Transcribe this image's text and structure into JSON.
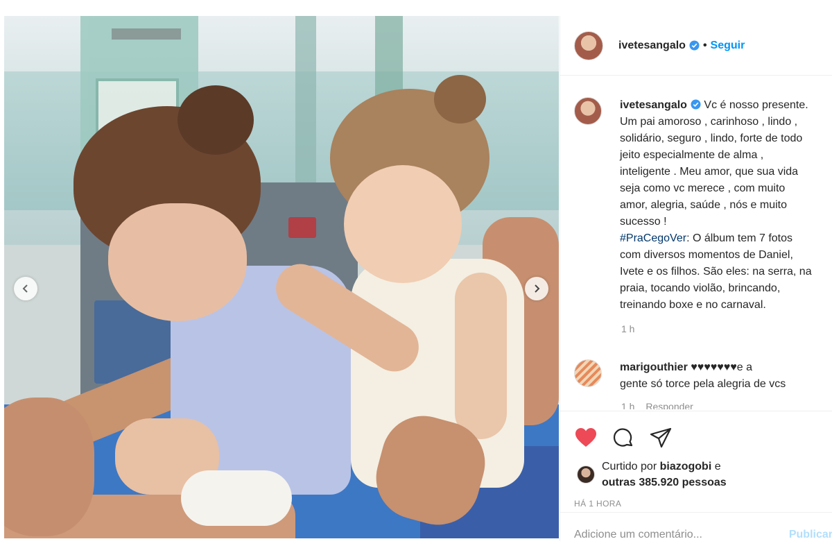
{
  "post": {
    "username": "ivetesangalo",
    "follow_label": "Seguir",
    "separator": "•",
    "caption_lines": [
      "Vc é nosso presente.",
      "Um pai amoroso , carinhoso , lindo ,",
      "solidário, seguro , lindo, forte de todo",
      "jeito especialmente de alma ,",
      "inteligente . Meu amor, que sua vida",
      "seja como vc merece , com muito",
      "amor, alegria, saúde , nós e muito",
      "sucesso !"
    ],
    "hashtag": "#PraCegoVer",
    "alt_text_lines": [
      ": O álbum tem 7 fotos",
      "com diversos momentos de Daniel,",
      "Ivete e os filhos. São eles: na serra, na",
      "praia, tocando violão, brincando,",
      "treinando boxe e no carnaval."
    ],
    "caption_time": "1 h"
  },
  "comment": {
    "username": "marigouthier",
    "hearts": "♥♥♥♥♥♥♥",
    "text_first": "e a",
    "text_second": "gente só torce pela alegria de vcs",
    "time": "1 h",
    "reply_label": "Responder"
  },
  "likes": {
    "prefix": "Curtido por",
    "user": "biazogobi",
    "suffix": "e",
    "others": "outras 385.920 pessoas"
  },
  "time_ago": "HÁ 1 HORA",
  "add_comment": {
    "placeholder": "Adicione um comentário...",
    "publish_label": "Publicar"
  },
  "icons": {
    "like": "heart-filled-icon",
    "comment": "comment-icon",
    "share": "share-icon",
    "prev": "chevron-left-icon",
    "next": "chevron-right-icon",
    "verified": "verified-badge-icon"
  },
  "colors": {
    "like": "#ed4956",
    "link": "#0095f6",
    "hashtag": "#00376b",
    "muted": "#8e8e8e",
    "verified": "#3897f0"
  }
}
